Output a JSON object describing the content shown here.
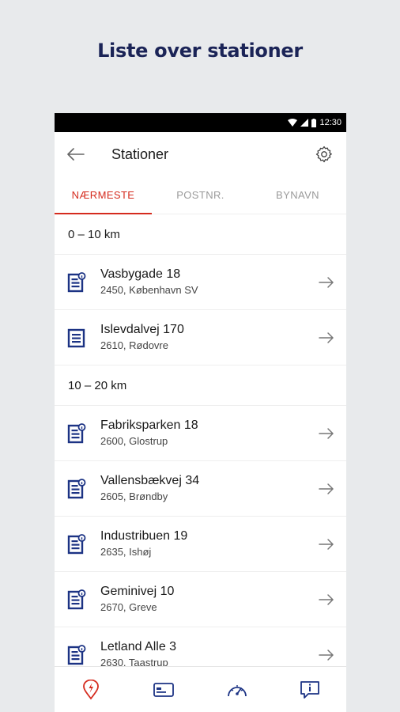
{
  "headline": "Liste over stationer",
  "statusbar": {
    "time": "12:30"
  },
  "appbar": {
    "title": "Stationer",
    "back_icon": "arrow-left-icon",
    "settings_icon": "gear-icon"
  },
  "tabs": [
    {
      "label": "NÆRMESTE",
      "active": true
    },
    {
      "label": "POSTNR.",
      "active": false
    },
    {
      "label": "BYNAVN",
      "active": false
    }
  ],
  "sections": [
    {
      "label": "0 – 10 km",
      "stations": [
        {
          "street": "Vasbygade 18",
          "city": "2450, København SV",
          "icon": "station-info-icon"
        },
        {
          "street": "Islevdalvej 170",
          "city": "2610, Rødovre",
          "icon": "station-icon"
        }
      ]
    },
    {
      "label": "10 – 20 km",
      "stations": [
        {
          "street": "Fabriksparken 18",
          "city": "2600, Glostrup",
          "icon": "station-info-icon"
        },
        {
          "street": "Vallensbækvej 34",
          "city": "2605, Brøndby",
          "icon": "station-info-icon"
        },
        {
          "street": "Industribuen 19",
          "city": "2635, Ishøj",
          "icon": "station-info-icon"
        },
        {
          "street": "Geminivej 10",
          "city": "2670, Greve",
          "icon": "station-info-icon"
        },
        {
          "street": "Letland Alle 3",
          "city": "2630, Taastrup",
          "icon": "station-info-icon"
        }
      ]
    }
  ],
  "bottom_nav": [
    {
      "icon": "location-pin-icon",
      "active": true
    },
    {
      "icon": "card-icon",
      "active": false
    },
    {
      "icon": "speedometer-icon",
      "active": false
    },
    {
      "icon": "info-chat-icon",
      "active": false
    }
  ],
  "colors": {
    "accent": "#d52b1e",
    "brand_navy": "#1b2457",
    "icon_blue": "#1c3384"
  }
}
